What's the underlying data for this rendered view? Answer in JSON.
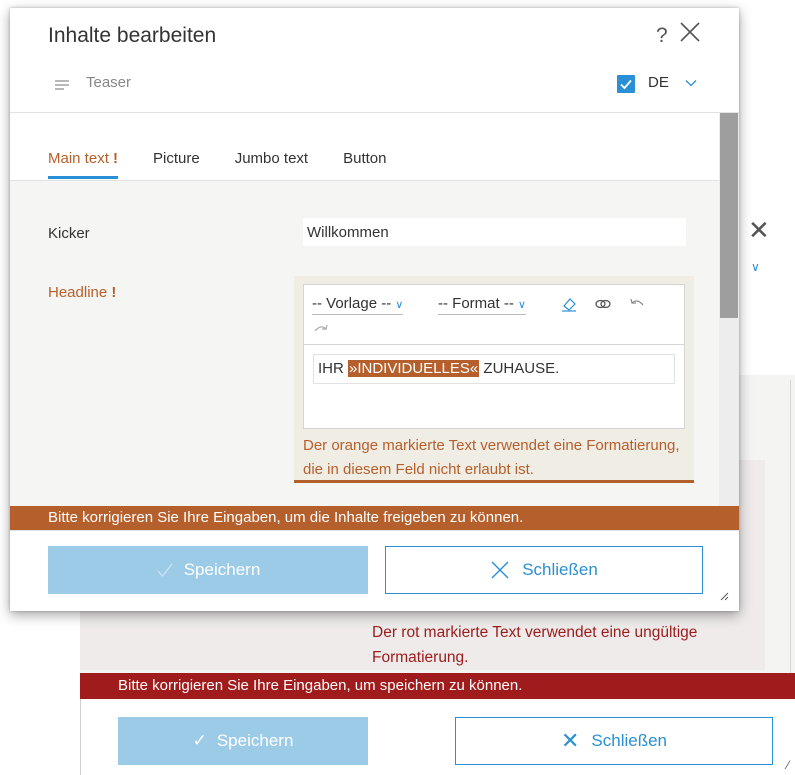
{
  "background_dialog": {
    "hint": "Der rot markierte Text verwendet eine ungültige Formatierung.",
    "error_bar": "Bitte korrigieren Sie Ihre Eingaben, um speichern zu können.",
    "save_label": "Speichern",
    "close_label": "Schließen"
  },
  "dialog": {
    "title": "Inhalte bearbeiten",
    "help": "?",
    "teaser_label": "Teaser",
    "language": "DE",
    "language_checked": true
  },
  "tabs": [
    {
      "label": "Main text",
      "required": "!",
      "active": true
    },
    {
      "label": "Picture",
      "required": "",
      "active": false
    },
    {
      "label": "Jumbo text",
      "required": "",
      "active": false
    },
    {
      "label": "Button",
      "required": "",
      "active": false
    }
  ],
  "form": {
    "kicker_label": "Kicker",
    "kicker_value": "Willkommen",
    "headline_label": "Headline",
    "headline_required": "!",
    "toolbar": {
      "template_select": "-- Vorlage --",
      "format_select": "-- Format --"
    },
    "headline_content": {
      "before": "IHR ",
      "highlighted": "»INDIVIDUELLES«",
      "after": " ZUHAUSE."
    },
    "editor_hint": "Der orange markierte Text verwendet eine Formatierung, die in diesem Feld nicht erlaubt ist."
  },
  "error_bar": "Bitte korrigieren Sie Ihre Eingaben, um die Inhalte freigeben zu können.",
  "footer": {
    "save_label": "Speichern",
    "close_label": "Schließen"
  },
  "colors": {
    "accent": "#2a8fd4",
    "warning": "#b5602c",
    "error": "#a01c1c",
    "save_disabled": "#9ccbe8"
  }
}
